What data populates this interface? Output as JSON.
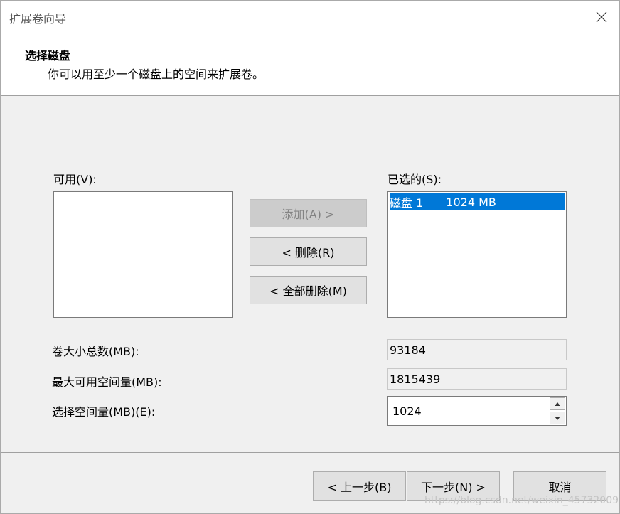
{
  "window": {
    "title": "扩展卷向导"
  },
  "header": {
    "title": "选择磁盘",
    "subtitle": "你可以用至少一个磁盘上的空间来扩展卷。"
  },
  "available": {
    "label": "可用(V):",
    "items": []
  },
  "selected": {
    "label": "已选的(S):",
    "items": [
      {
        "disk": "磁盘 1",
        "size": "1024 MB"
      }
    ]
  },
  "buttons": {
    "add": "添加(A) >",
    "remove": "< 删除(R)",
    "remove_all": "< 全部删除(M)"
  },
  "fields": {
    "total_label": "卷大小总数(MB):",
    "total_value": "93184",
    "max_label": "最大可用空间量(MB):",
    "max_value": "1815439",
    "select_label": "选择空间量(MB)(E):",
    "select_value": "1024"
  },
  "footer": {
    "back": "< 上一步(B)",
    "next": "下一步(N) >",
    "cancel": "取消"
  },
  "watermark": "https://blog.csdn.net/weixin_45732009",
  "colors": {
    "selection": "#0078d7",
    "header_bg": "#ffffff",
    "body_bg": "#f0f0f0"
  },
  "icons": {
    "close": "close-icon",
    "spin_up": "spin-up-icon",
    "spin_down": "spin-down-icon"
  }
}
